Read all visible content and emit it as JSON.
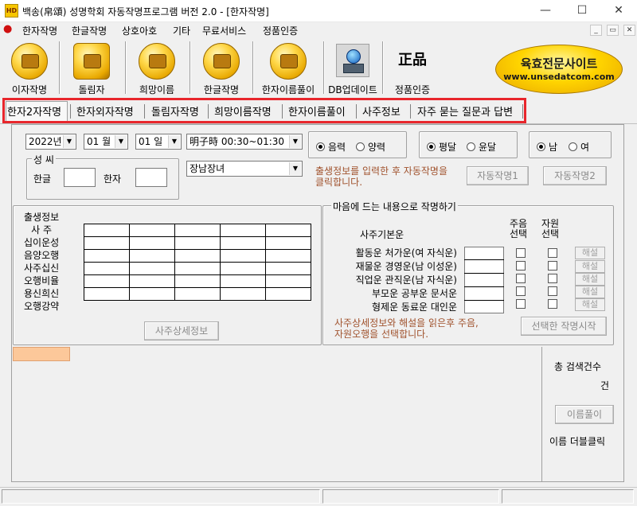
{
  "window": {
    "title": "백송(帛頌) 성명학회 자동작명프로그램 버전 2.0 - [한자작명]",
    "app_icon_text": "HD",
    "minimize": "—",
    "maximize": "☐",
    "close": "✕"
  },
  "menu": {
    "items": [
      "한자작명",
      "한글작명",
      "상호아호",
      "기타",
      "무료서비스",
      "정품인증"
    ],
    "mdi_buttons": [
      "_",
      "▭",
      "✕"
    ]
  },
  "toolbar": {
    "buttons": [
      "이자작명",
      "돌림자",
      "희망이름",
      "한글작명",
      "한자이름풀이",
      "DB업데이트",
      "정품인증"
    ],
    "genuine_icon_text": "正品",
    "site_banner": {
      "title": "육효전문사이트",
      "url": "www.unsedatcom.com"
    }
  },
  "tabs": [
    "한자2자작명",
    "한자외자작명",
    "돌림자작명",
    "희망이름작명",
    "한자이름풀이",
    "사주정보",
    "자주 묻는 질문과 답변"
  ],
  "birth": {
    "year": "2022년",
    "month": "01 월",
    "day": "01 일",
    "hour": "明子時 00:30~01:30",
    "order": "장남장녀"
  },
  "calendar": {
    "solar_label": "음력",
    "lunar_label": "양력",
    "selected": "음력"
  },
  "leap": {
    "normal_label": "평달",
    "leap_label": "윤달",
    "selected": "평달"
  },
  "gender": {
    "male_label": "남",
    "female_label": "여",
    "selected": "남"
  },
  "surname": {
    "group_title": "성 씨",
    "hangul_label": "한글",
    "hanja_label": "한자"
  },
  "instruction1": "출생정보를 입력한 후 자동작명을 클릭합니다.",
  "auto_buttons": [
    "자동작명1",
    "자동작명2"
  ],
  "saju": {
    "labels": [
      "출생정보",
      "사 주",
      "십이운성",
      "음양오행",
      "사주십신",
      "오행비율",
      "용신희신",
      "오행강약"
    ],
    "detail_button": "사주상세정보"
  },
  "naming": {
    "group_title": "마음에 드는 내용으로 작명하기",
    "col_basic": "사주기본운",
    "col_main1": "주음",
    "col_main2": "선택",
    "col_res1": "자원",
    "col_res2": "선택",
    "rows": [
      "활동운 처가운(여 자식운)",
      "재물운 경영운(남 이성운)",
      "직업운 관직운(남 자식운)",
      "부모운 공부운 문서운",
      "형제운 동료운 대인운"
    ],
    "explain_label": "해설",
    "instruction": "사주상세정보와 해설을 읽은후 주음,자원오행을 선택합니다.",
    "start_button": "선택한 작명시작"
  },
  "results": {
    "count_label": "총 검색건수",
    "count_unit": "건",
    "interpret_button": "이름풀이",
    "dblclick_hint": "이름 더블클릭"
  }
}
